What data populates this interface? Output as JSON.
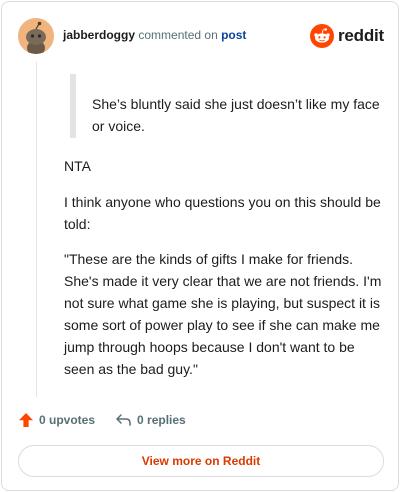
{
  "header": {
    "username": "jabberdoggy",
    "action_text": "commented on",
    "post_link": "post",
    "logo_text": "reddit"
  },
  "comment": {
    "quote": "She’s bluntly said she just doesn’t like my face or voice.",
    "paragraphs": [
      "NTA",
      "I think anyone who questions you on this should be told:",
      "\"These are the kinds of gifts I make for friends. She's made it very clear that we are not friends. I'm not sure what game she is playing, but suspect it is some sort of power play to see if she can make me jump through hoops because I don't want to be seen as the bad guy.\""
    ]
  },
  "actions": {
    "upvotes": "0 upvotes",
    "replies": "0 replies"
  },
  "footer": {
    "view_more": "View more on Reddit"
  },
  "colors": {
    "brand": "#ff4500",
    "link": "#0a449b",
    "button_text": "#d93a00",
    "muted": "#576f76"
  }
}
